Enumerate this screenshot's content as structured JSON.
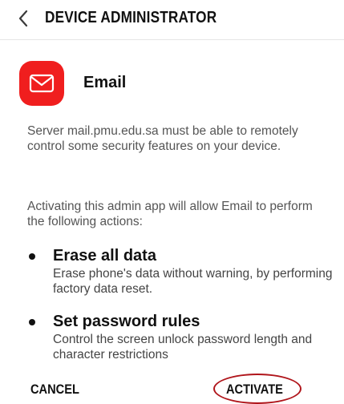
{
  "header": {
    "back_icon": "chevron-left-icon",
    "title": "DEVICE ADMINISTRATOR"
  },
  "app": {
    "icon": "envelope-icon",
    "icon_color": "#f01e1e",
    "name": "Email"
  },
  "description": "Server mail.pmu.edu.sa must be able to remotely control some security features on your device.",
  "actions_intro": "Activating this admin app will allow Email to perform the following actions:",
  "actions": [
    {
      "title": "Erase all data",
      "description": "Erase phone's data without warning, by performing factory data reset."
    },
    {
      "title": "Set password rules",
      "description": "Control the screen unlock password length and character restrictions"
    }
  ],
  "buttons": {
    "cancel": "CANCEL",
    "activate": "ACTIVATE"
  },
  "annotation_color": "#b0151b"
}
